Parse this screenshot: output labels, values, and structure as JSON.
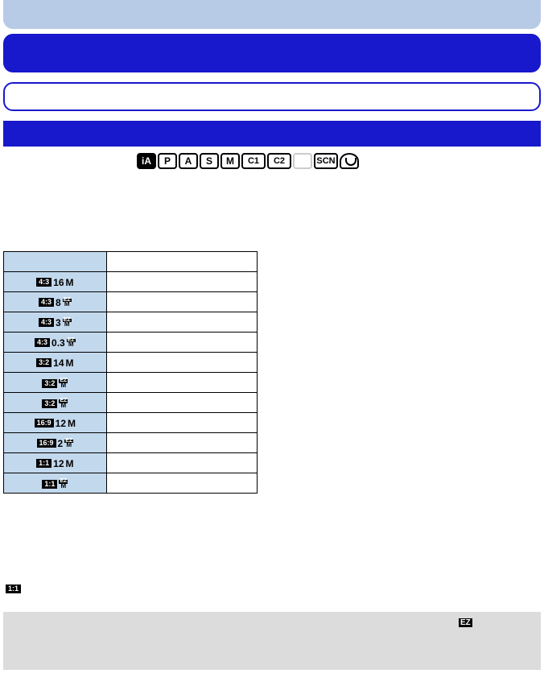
{
  "modes": {
    "ia": "iA",
    "p": "P",
    "a": "A",
    "s": "S",
    "m": "M",
    "c1": "C1",
    "c2": "C2",
    "scn": "SCN"
  },
  "table": {
    "header1": "",
    "header2": "",
    "rows": [
      {
        "ratio": "4:3",
        "size": "16",
        "unit": "M",
        "ez": false
      },
      {
        "ratio": "4:3",
        "size": "8",
        "unit": "M",
        "ez": true
      },
      {
        "ratio": "4:3",
        "size": "3",
        "unit": "M",
        "ez": true
      },
      {
        "ratio": "4:3",
        "size": "0.3",
        "unit": "M",
        "ez": true
      },
      {
        "ratio": "3:2",
        "size": "14",
        "unit": "M",
        "ez": false
      },
      {
        "ratio": "3:2",
        "size": "",
        "unit": "M",
        "ez": true
      },
      {
        "ratio": "3:2",
        "size": "",
        "unit": "M",
        "ez": true
      },
      {
        "ratio": "16:9",
        "size": "12",
        "unit": "M",
        "ez": false
      },
      {
        "ratio": "16:9",
        "size": "2",
        "unit": "M",
        "ez": true
      },
      {
        "ratio": "1:1",
        "size": "12",
        "unit": "M",
        "ez": false
      },
      {
        "ratio": "1:1",
        "size": "",
        "unit": "M",
        "ez": true
      }
    ]
  },
  "lone_ratio": "1:1",
  "footer_ez": "EZ"
}
